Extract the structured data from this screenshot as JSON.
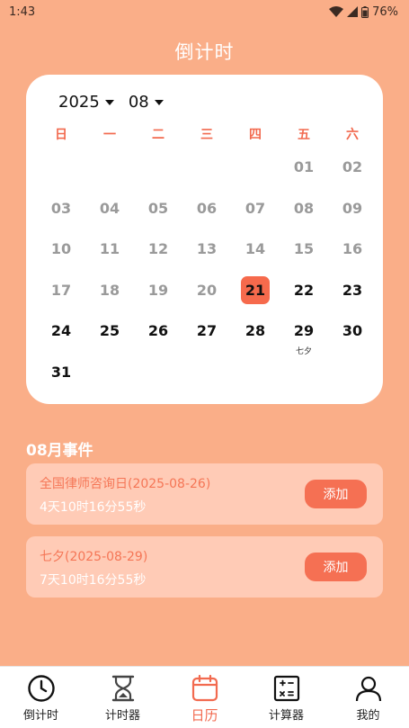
{
  "status_bar": {
    "time": "1:43",
    "battery": "76%"
  },
  "title": "倒计时",
  "calendar": {
    "year": "2025",
    "month": "08",
    "weekdays": [
      "日",
      "一",
      "二",
      "三",
      "四",
      "五",
      "六"
    ],
    "weeks": [
      [
        {
          "d": ""
        },
        {
          "d": ""
        },
        {
          "d": ""
        },
        {
          "d": ""
        },
        {
          "d": ""
        },
        {
          "d": "01",
          "s": "past"
        },
        {
          "d": "02",
          "s": "past"
        }
      ],
      [
        {
          "d": "03",
          "s": "past"
        },
        {
          "d": "04",
          "s": "past"
        },
        {
          "d": "05",
          "s": "past"
        },
        {
          "d": "06",
          "s": "past"
        },
        {
          "d": "07",
          "s": "past"
        },
        {
          "d": "08",
          "s": "past"
        },
        {
          "d": "09",
          "s": "past"
        }
      ],
      [
        {
          "d": "10",
          "s": "past"
        },
        {
          "d": "11",
          "s": "past"
        },
        {
          "d": "12",
          "s": "past"
        },
        {
          "d": "13",
          "s": "past"
        },
        {
          "d": "14",
          "s": "past"
        },
        {
          "d": "15",
          "s": "past"
        },
        {
          "d": "16",
          "s": "past"
        }
      ],
      [
        {
          "d": "17",
          "s": "past"
        },
        {
          "d": "18",
          "s": "past"
        },
        {
          "d": "19",
          "s": "past"
        },
        {
          "d": "20",
          "s": "past"
        },
        {
          "d": "21",
          "s": "today"
        },
        {
          "d": "22",
          "s": "future"
        },
        {
          "d": "23",
          "s": "future"
        }
      ],
      [
        {
          "d": "24",
          "s": "future"
        },
        {
          "d": "25",
          "s": "future"
        },
        {
          "d": "26",
          "s": "future"
        },
        {
          "d": "27",
          "s": "future"
        },
        {
          "d": "28",
          "s": "future"
        },
        {
          "d": "29",
          "s": "future",
          "note": "七夕"
        },
        {
          "d": "30",
          "s": "future"
        }
      ],
      [
        {
          "d": "31",
          "s": "future"
        },
        {
          "d": ""
        },
        {
          "d": ""
        },
        {
          "d": ""
        },
        {
          "d": ""
        },
        {
          "d": ""
        },
        {
          "d": ""
        }
      ]
    ]
  },
  "events_section": {
    "title": "08月事件",
    "items": [
      {
        "name": "全国律师咨询日(2025-08-26)",
        "countdown": "4天10时16分55秒",
        "button": "添加"
      },
      {
        "name": "七夕(2025-08-29)",
        "countdown": "7天10时16分55秒",
        "button": "添加"
      }
    ]
  },
  "bottom_nav": {
    "items": [
      {
        "label": "倒计时",
        "icon": "clock-icon"
      },
      {
        "label": "计时器",
        "icon": "hourglass-icon"
      },
      {
        "label": "日历",
        "icon": "calendar-icon",
        "active": true
      },
      {
        "label": "计算器",
        "icon": "calculator-icon"
      },
      {
        "label": "我的",
        "icon": "user-icon"
      }
    ]
  },
  "colors": {
    "background": "#FAAE88",
    "accent": "#F26A4F",
    "today": "#F66A4C",
    "event_card": "#FFCBB6"
  }
}
